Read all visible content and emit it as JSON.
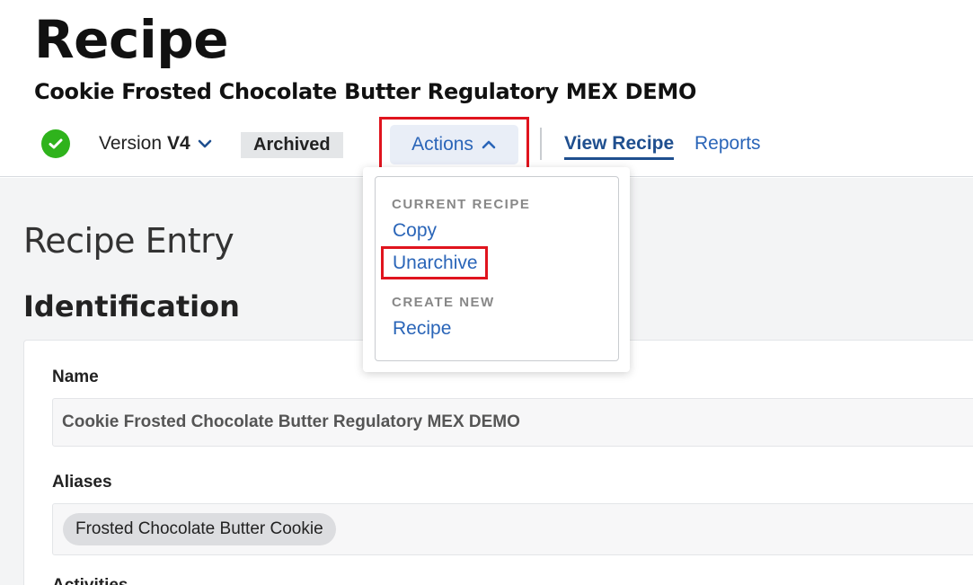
{
  "header": {
    "title": "Recipe",
    "recipe_name": "Cookie Frosted Chocolate Butter Regulatory MEX DEMO",
    "status_icon": "check-circle-icon",
    "status_color": "#2fb31c",
    "version_label": "Version",
    "version_value": "V4",
    "badge": "Archived",
    "actions_label": "Actions",
    "tabs": [
      {
        "label": "View Recipe",
        "active": true
      },
      {
        "label": "Reports",
        "active": false
      }
    ]
  },
  "actions_menu": {
    "sections": [
      {
        "heading": "CURRENT RECIPE",
        "items": [
          "Copy",
          "Unarchive"
        ]
      },
      {
        "heading": "CREATE NEW",
        "items": [
          "Recipe"
        ]
      }
    ]
  },
  "main": {
    "section_title": "Recipe Entry",
    "identification_title": "Identification",
    "fields": {
      "name_label": "Name",
      "name_value": "Cookie Frosted Chocolate Butter Regulatory MEX DEMO",
      "aliases_label": "Aliases",
      "aliases": [
        "Frosted Chocolate Butter Cookie"
      ],
      "next_label": "Activities"
    }
  },
  "colors": {
    "accent": "#2a65b8",
    "active_tab": "#1f4f8f",
    "highlight": "#e0141e"
  }
}
